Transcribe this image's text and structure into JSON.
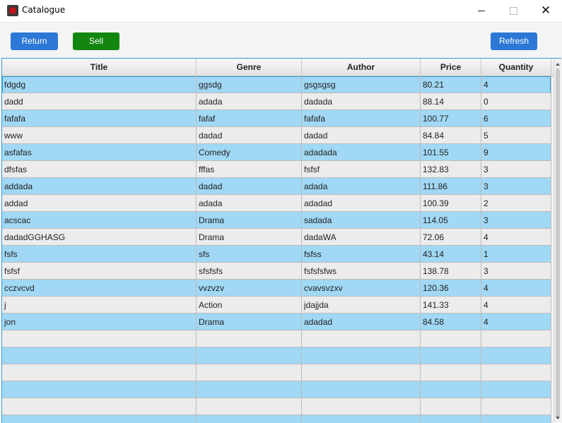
{
  "window": {
    "title": "Catalogue"
  },
  "toolbar": {
    "return_label": "Return",
    "sell_label": "Sell",
    "refresh_label": "Refresh"
  },
  "table": {
    "columns": [
      "Title",
      "Genre",
      "Author",
      "Price",
      "Quantity"
    ],
    "rows": [
      [
        "fdgdg",
        "ggsdg",
        "gsgsgsg",
        "80.21",
        "4"
      ],
      [
        "dadd",
        "adada",
        "dadada",
        "88.14",
        "0"
      ],
      [
        "fafafa",
        "fafaf",
        "fafafa",
        "100.77",
        "6"
      ],
      [
        "www",
        "dadad",
        "dadad",
        "84.84",
        "5"
      ],
      [
        "asfafas",
        "Comedy",
        "adadada",
        "101.55",
        "9"
      ],
      [
        "dfsfas",
        "fffas",
        "fsfsf",
        "132.83",
        "3"
      ],
      [
        "addada",
        "dadad",
        "adada",
        "111.86",
        "3"
      ],
      [
        "addad",
        "adada",
        "adadad",
        "100.39",
        "2"
      ],
      [
        "acscac",
        "Drama",
        "sadada",
        "114.05",
        "3"
      ],
      [
        "dadadGGHASG",
        "Drama",
        "dadaWA",
        "72.06",
        "4"
      ],
      [
        "fsfs",
        "sfs",
        "fsfss",
        "43.14",
        "1"
      ],
      [
        "fsfsf",
        "sfsfsfs",
        "fsfsfsfws",
        "138.78",
        "3"
      ],
      [
        "cczvcvd",
        "vvzvzv",
        "cvavsvzxv",
        "120.36",
        "4"
      ],
      [
        "j",
        "Action",
        "jdajjda",
        "141.33",
        "4"
      ],
      [
        "jon",
        "Drama",
        "adadad",
        "84.58",
        "4"
      ]
    ],
    "selected_row": 0
  }
}
